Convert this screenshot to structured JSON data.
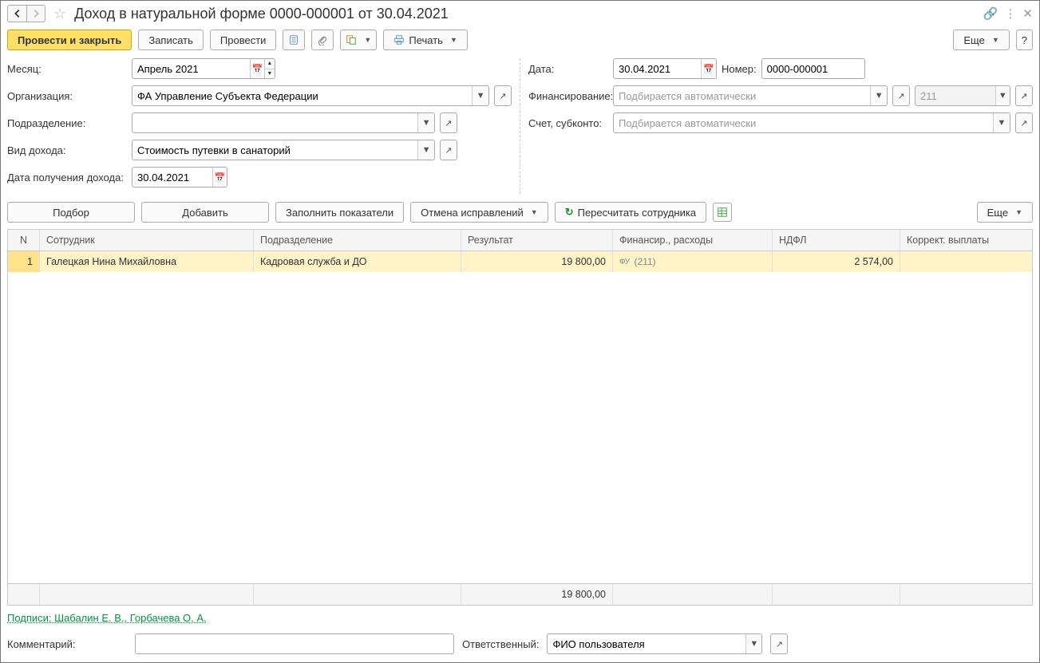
{
  "title": "Доход в натуральной форме 0000-000001 от 30.04.2021",
  "toolbar": {
    "post_close": "Провести и закрыть",
    "save": "Записать",
    "post": "Провести",
    "print": "Печать",
    "more": "Еще",
    "help": "?"
  },
  "labels": {
    "month": "Месяц:",
    "org": "Организация:",
    "dept": "Подразделение:",
    "income_type": "Вид дохода:",
    "income_date": "Дата получения дохода:",
    "date": "Дата:",
    "number": "Номер:",
    "financing": "Финансирование:",
    "account": "Счет, субконто:",
    "comment": "Комментарий:",
    "responsible": "Ответственный:"
  },
  "values": {
    "month": "Апрель 2021",
    "org": "ФА Управление Субъекта Федерации",
    "dept": "",
    "income_type": "Стоимость путевки в санаторий",
    "income_date": "30.04.2021",
    "date": "30.04.2021",
    "number": "0000-000001",
    "fin_placeholder": "Подбирается автоматически",
    "fin_code": "211",
    "account_placeholder": "Подбирается автоматически",
    "comment": "",
    "responsible": "ФИО пользователя"
  },
  "table_toolbar": {
    "pick": "Подбор",
    "add": "Добавить",
    "fill": "Заполнить показатели",
    "cancel_corr": "Отмена исправлений",
    "recalc": "Пересчитать сотрудника",
    "more": "Еще"
  },
  "grid": {
    "headers": {
      "n": "N",
      "emp": "Сотрудник",
      "dep": "Подразделение",
      "res": "Результат",
      "fin": "Финансир., расходы",
      "tax": "НДФЛ",
      "cor": "Коррект. выплаты"
    },
    "rows": [
      {
        "n": "1",
        "emp": "Галецкая Нина Михайловна",
        "dep": "Кадровая служба и ДО",
        "res": "19 800,00",
        "fin_tag": "ФУ",
        "fin_code": "(211)",
        "tax": "2 574,00",
        "cor": ""
      }
    ],
    "footer_res": "19 800,00"
  },
  "signatures": "Подписи: Шабалин Е. В., Горбачева О. А."
}
